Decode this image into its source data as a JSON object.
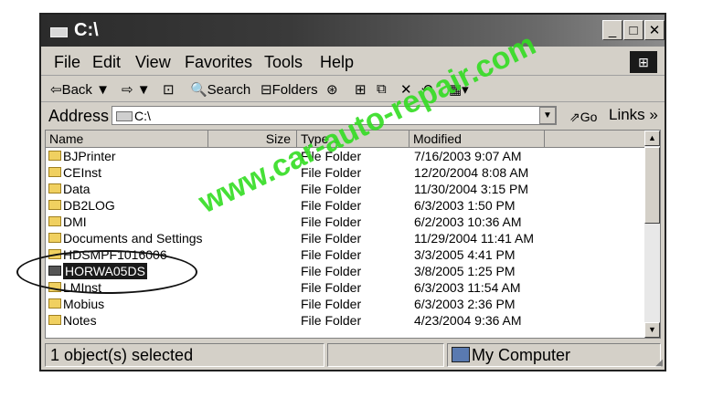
{
  "window": {
    "title": "C:\\"
  },
  "title_buttons": {
    "minimize": "_",
    "maximize": "□",
    "close": "✕"
  },
  "menu": [
    {
      "label": "File"
    },
    {
      "label": "Edit"
    },
    {
      "label": "View"
    },
    {
      "label": "Favorites"
    },
    {
      "label": "Tools"
    },
    {
      "label": "Help"
    }
  ],
  "toolbar": {
    "back": "⇦Back ▼",
    "forward": "⇨ ▼",
    "up": "⊡",
    "search": "🔍Search",
    "folders": "⊟Folders",
    "history": "⊛",
    "move": "⊞",
    "copy": "⧉",
    "delete": "✕",
    "undo": "↶",
    "views": "▦▾"
  },
  "address": {
    "label": "Address",
    "value": "C:\\",
    "go": "⇗Go",
    "links": "Links »"
  },
  "columns": {
    "name": "Name",
    "size": "Size",
    "type": "Type",
    "modified": "Modified"
  },
  "files": [
    {
      "name": "BJPrinter",
      "type": "File Folder",
      "modified": "7/16/2003 9:07 AM"
    },
    {
      "name": "CEInst",
      "type": "File Folder",
      "modified": "12/20/2004 8:08 AM"
    },
    {
      "name": "Data",
      "type": "File Folder",
      "modified": "11/30/2004 3:15 PM"
    },
    {
      "name": "DB2LOG",
      "type": "File Folder",
      "modified": "6/3/2003 1:50 PM"
    },
    {
      "name": "DMI",
      "type": "File Folder",
      "modified": "6/2/2003 10:36 AM"
    },
    {
      "name": "Documents and Settings",
      "type": "File Folder",
      "modified": "11/29/2004 11:41 AM"
    },
    {
      "name": "HDSMPF1016006",
      "type": "File Folder",
      "modified": "3/3/2005 4:41 PM"
    },
    {
      "name": "HORWA05DS",
      "type": "File Folder",
      "modified": "3/8/2005 1:25 PM"
    },
    {
      "name": "LMInst",
      "type": "File Folder",
      "modified": "6/3/2003 11:54 AM"
    },
    {
      "name": "Mobius",
      "type": "File Folder",
      "modified": "6/3/2003 2:36 PM"
    },
    {
      "name": "Notes",
      "type": "File Folder",
      "modified": "4/23/2004 9:36 AM"
    }
  ],
  "status": {
    "selected": "1 object(s) selected",
    "location": "My Computer"
  },
  "watermark": "www.car-auto-repair.com",
  "colors": {
    "watermark": "#33dd22",
    "selection": "#1a1a1a"
  }
}
